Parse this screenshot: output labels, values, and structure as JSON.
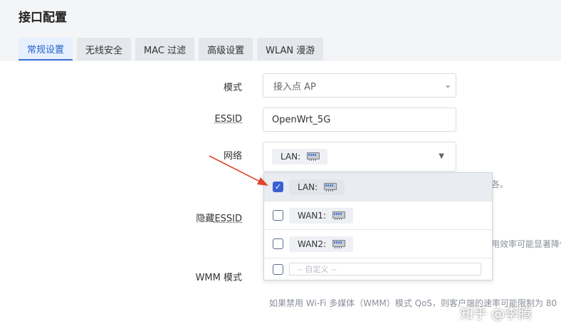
{
  "page": {
    "title": "接口配置"
  },
  "tabs": [
    {
      "label": "常规设置",
      "active": true
    },
    {
      "label": "无线安全",
      "active": false
    },
    {
      "label": "MAC 过滤",
      "active": false
    },
    {
      "label": "高级设置",
      "active": false
    },
    {
      "label": "WLAN 漫游",
      "active": false
    }
  ],
  "form": {
    "mode": {
      "label": "模式",
      "value": "接入点 AP"
    },
    "essid": {
      "label": "ESSID",
      "value": "OpenWrt_5G"
    },
    "network": {
      "label": "网络",
      "selected_tag": "LAN:",
      "hint_tail": "各。"
    },
    "hide_essid": {
      "label_prefix": "隐藏",
      "label_suffix": "ESSID",
      "hint_tail": "用效率可能显著降低"
    },
    "wmm": {
      "label": "WMM 模式",
      "hint": "如果禁用 Wi-Fi 多媒体（WMM）模式 QoS，则客户端的速率可能限制为 80"
    }
  },
  "dropdown": {
    "options": [
      {
        "label": "LAN:",
        "checked": true
      },
      {
        "label": "WAN1:",
        "checked": false
      },
      {
        "label": "WAN2:",
        "checked": false
      }
    ],
    "custom_placeholder": "-- 自定义 --"
  },
  "watermark": "知乎 @李腾",
  "colors": {
    "accent": "#3c5fd1",
    "arrow": "#e0452f"
  }
}
